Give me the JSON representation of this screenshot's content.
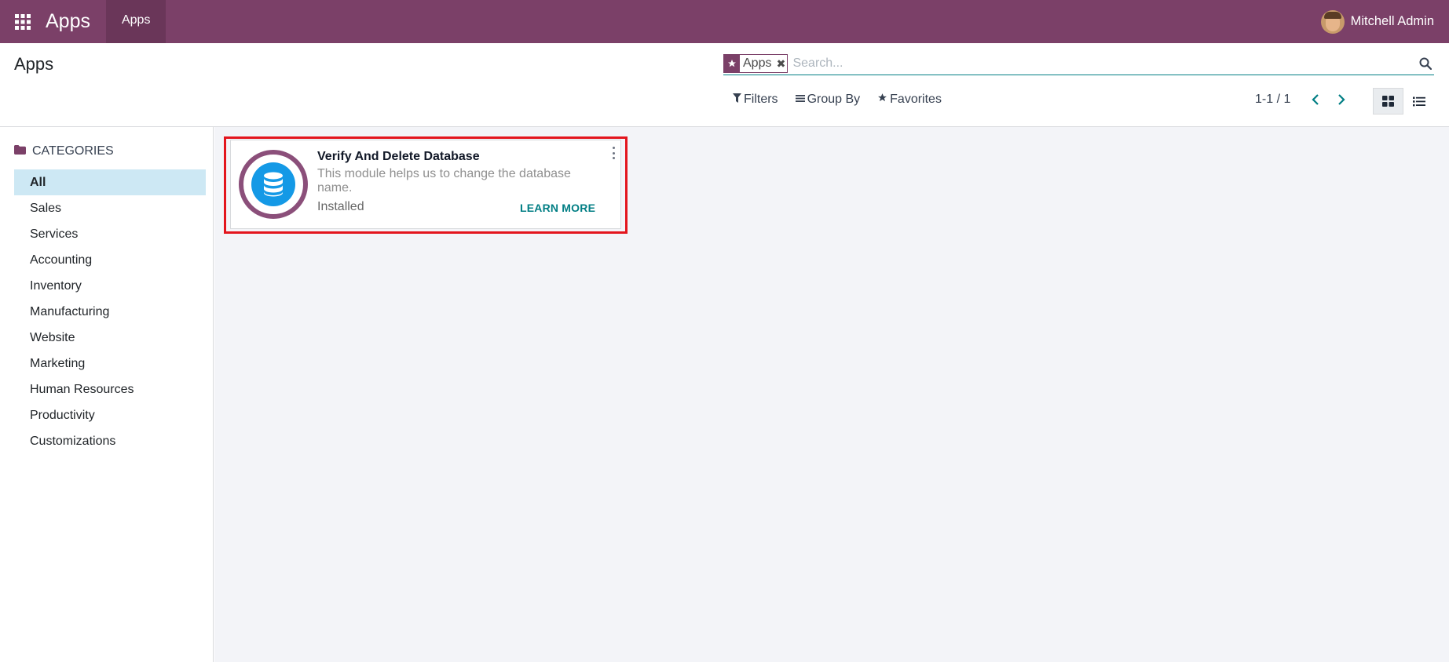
{
  "navbar": {
    "app_name": "Apps",
    "menu_item": "Apps",
    "user_name": "Mitchell Admin"
  },
  "control_panel": {
    "title": "Apps",
    "search": {
      "facet_label": "Apps",
      "placeholder": "Search..."
    },
    "buttons": {
      "filters": "Filters",
      "group_by": "Group By",
      "favorites": "Favorites"
    },
    "pager": "1-1 / 1"
  },
  "sidebar": {
    "header": "CATEGORIES",
    "items": [
      {
        "label": "All",
        "active": true
      },
      {
        "label": "Sales"
      },
      {
        "label": "Services"
      },
      {
        "label": "Accounting"
      },
      {
        "label": "Inventory"
      },
      {
        "label": "Manufacturing"
      },
      {
        "label": "Website"
      },
      {
        "label": "Marketing"
      },
      {
        "label": "Human Resources"
      },
      {
        "label": "Productivity"
      },
      {
        "label": "Customizations"
      }
    ]
  },
  "cards": [
    {
      "title": "Verify And Delete Database",
      "description": "This module helps us to change the database name.",
      "status": "Installed",
      "action": "LEARN MORE",
      "icon": "database-icon"
    }
  ],
  "colors": {
    "brand": "#7b4068",
    "accent": "#017e84",
    "highlight_border": "#e3151d",
    "active_category": "#cde8f4"
  }
}
